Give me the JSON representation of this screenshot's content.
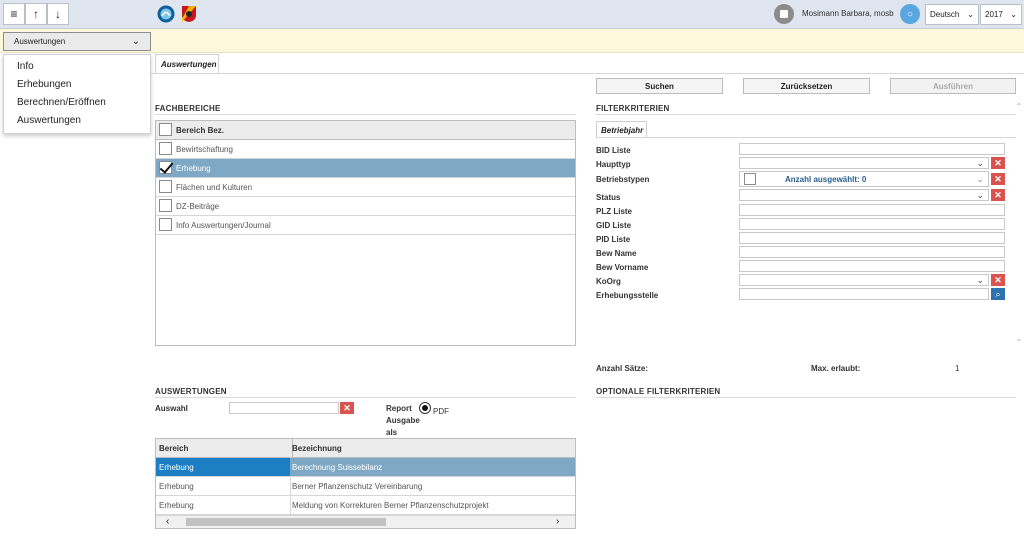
{
  "topbar": {
    "menu_icon": "hamburger-icon",
    "up_icon": "arrow-up-icon",
    "down_icon": "arrow-down-icon",
    "user_name": "Mosimann Barbara, mosb",
    "language": "Deutsch",
    "year": "2017"
  },
  "module_select": {
    "value": "Auswertungen",
    "options": [
      "Info",
      "Erhebungen",
      "Berechnen/Eröffnen",
      "Auswertungen"
    ]
  },
  "tabs": {
    "active": "Auswertungen"
  },
  "actions": {
    "search": "Suchen",
    "reset": "Zurücksetzen",
    "execute": "Ausführen"
  },
  "fachbereiche": {
    "title": "Fachbereiche",
    "header": "Bereich Bez.",
    "rows": [
      {
        "label": "Bewirtschaftung",
        "checked": false
      },
      {
        "label": "Erhebung",
        "checked": true
      },
      {
        "label": "Flächen und Kulturen",
        "checked": false
      },
      {
        "label": "DZ-Beiträge",
        "checked": false
      },
      {
        "label": "Info Auswertungen/Journal",
        "checked": false
      }
    ]
  },
  "filter": {
    "title": "Filterkriterien",
    "tab": "Betriebjahr",
    "fields": {
      "bid": "BID Liste",
      "haupttyp": "Haupttyp",
      "betriebstypen": "Betriebstypen",
      "betriebstypen_value": "Anzahl ausgewählt: 0",
      "status": "Status",
      "plz": "PLZ Liste",
      "gid": "GID Liste",
      "pid": "PID Liste",
      "bew_name": "Bew Name",
      "bew_vorname": "Bew Vorname",
      "koorg": "KoOrg",
      "erhebungsstelle": "Erhebungsstelle"
    },
    "count_label": "Anzahl Sätze:",
    "max_label": "Max. erlaubt:",
    "max_value": "1",
    "optional_title": "Optionale Filterkriterien"
  },
  "auswertungen": {
    "title": "Auswertungen",
    "auswahl_label": "Auswahl",
    "report_line1": "Report",
    "report_line2": "Ausgabe",
    "report_line3": "als",
    "pdf_label": "PDF",
    "columns": [
      "Bereich",
      "Bezeichnung"
    ],
    "rows": [
      {
        "bereich": "Erhebung",
        "bezeichnung": "Berechnung Suissebilanz"
      },
      {
        "bereich": "Erhebung",
        "bezeichnung": "Berner Pflanzenschutz Vereinbarung"
      },
      {
        "bereich": "Erhebung",
        "bezeichnung": "Meldung von Korrekturen Berner Pflanzenschutzprojekt"
      }
    ]
  }
}
